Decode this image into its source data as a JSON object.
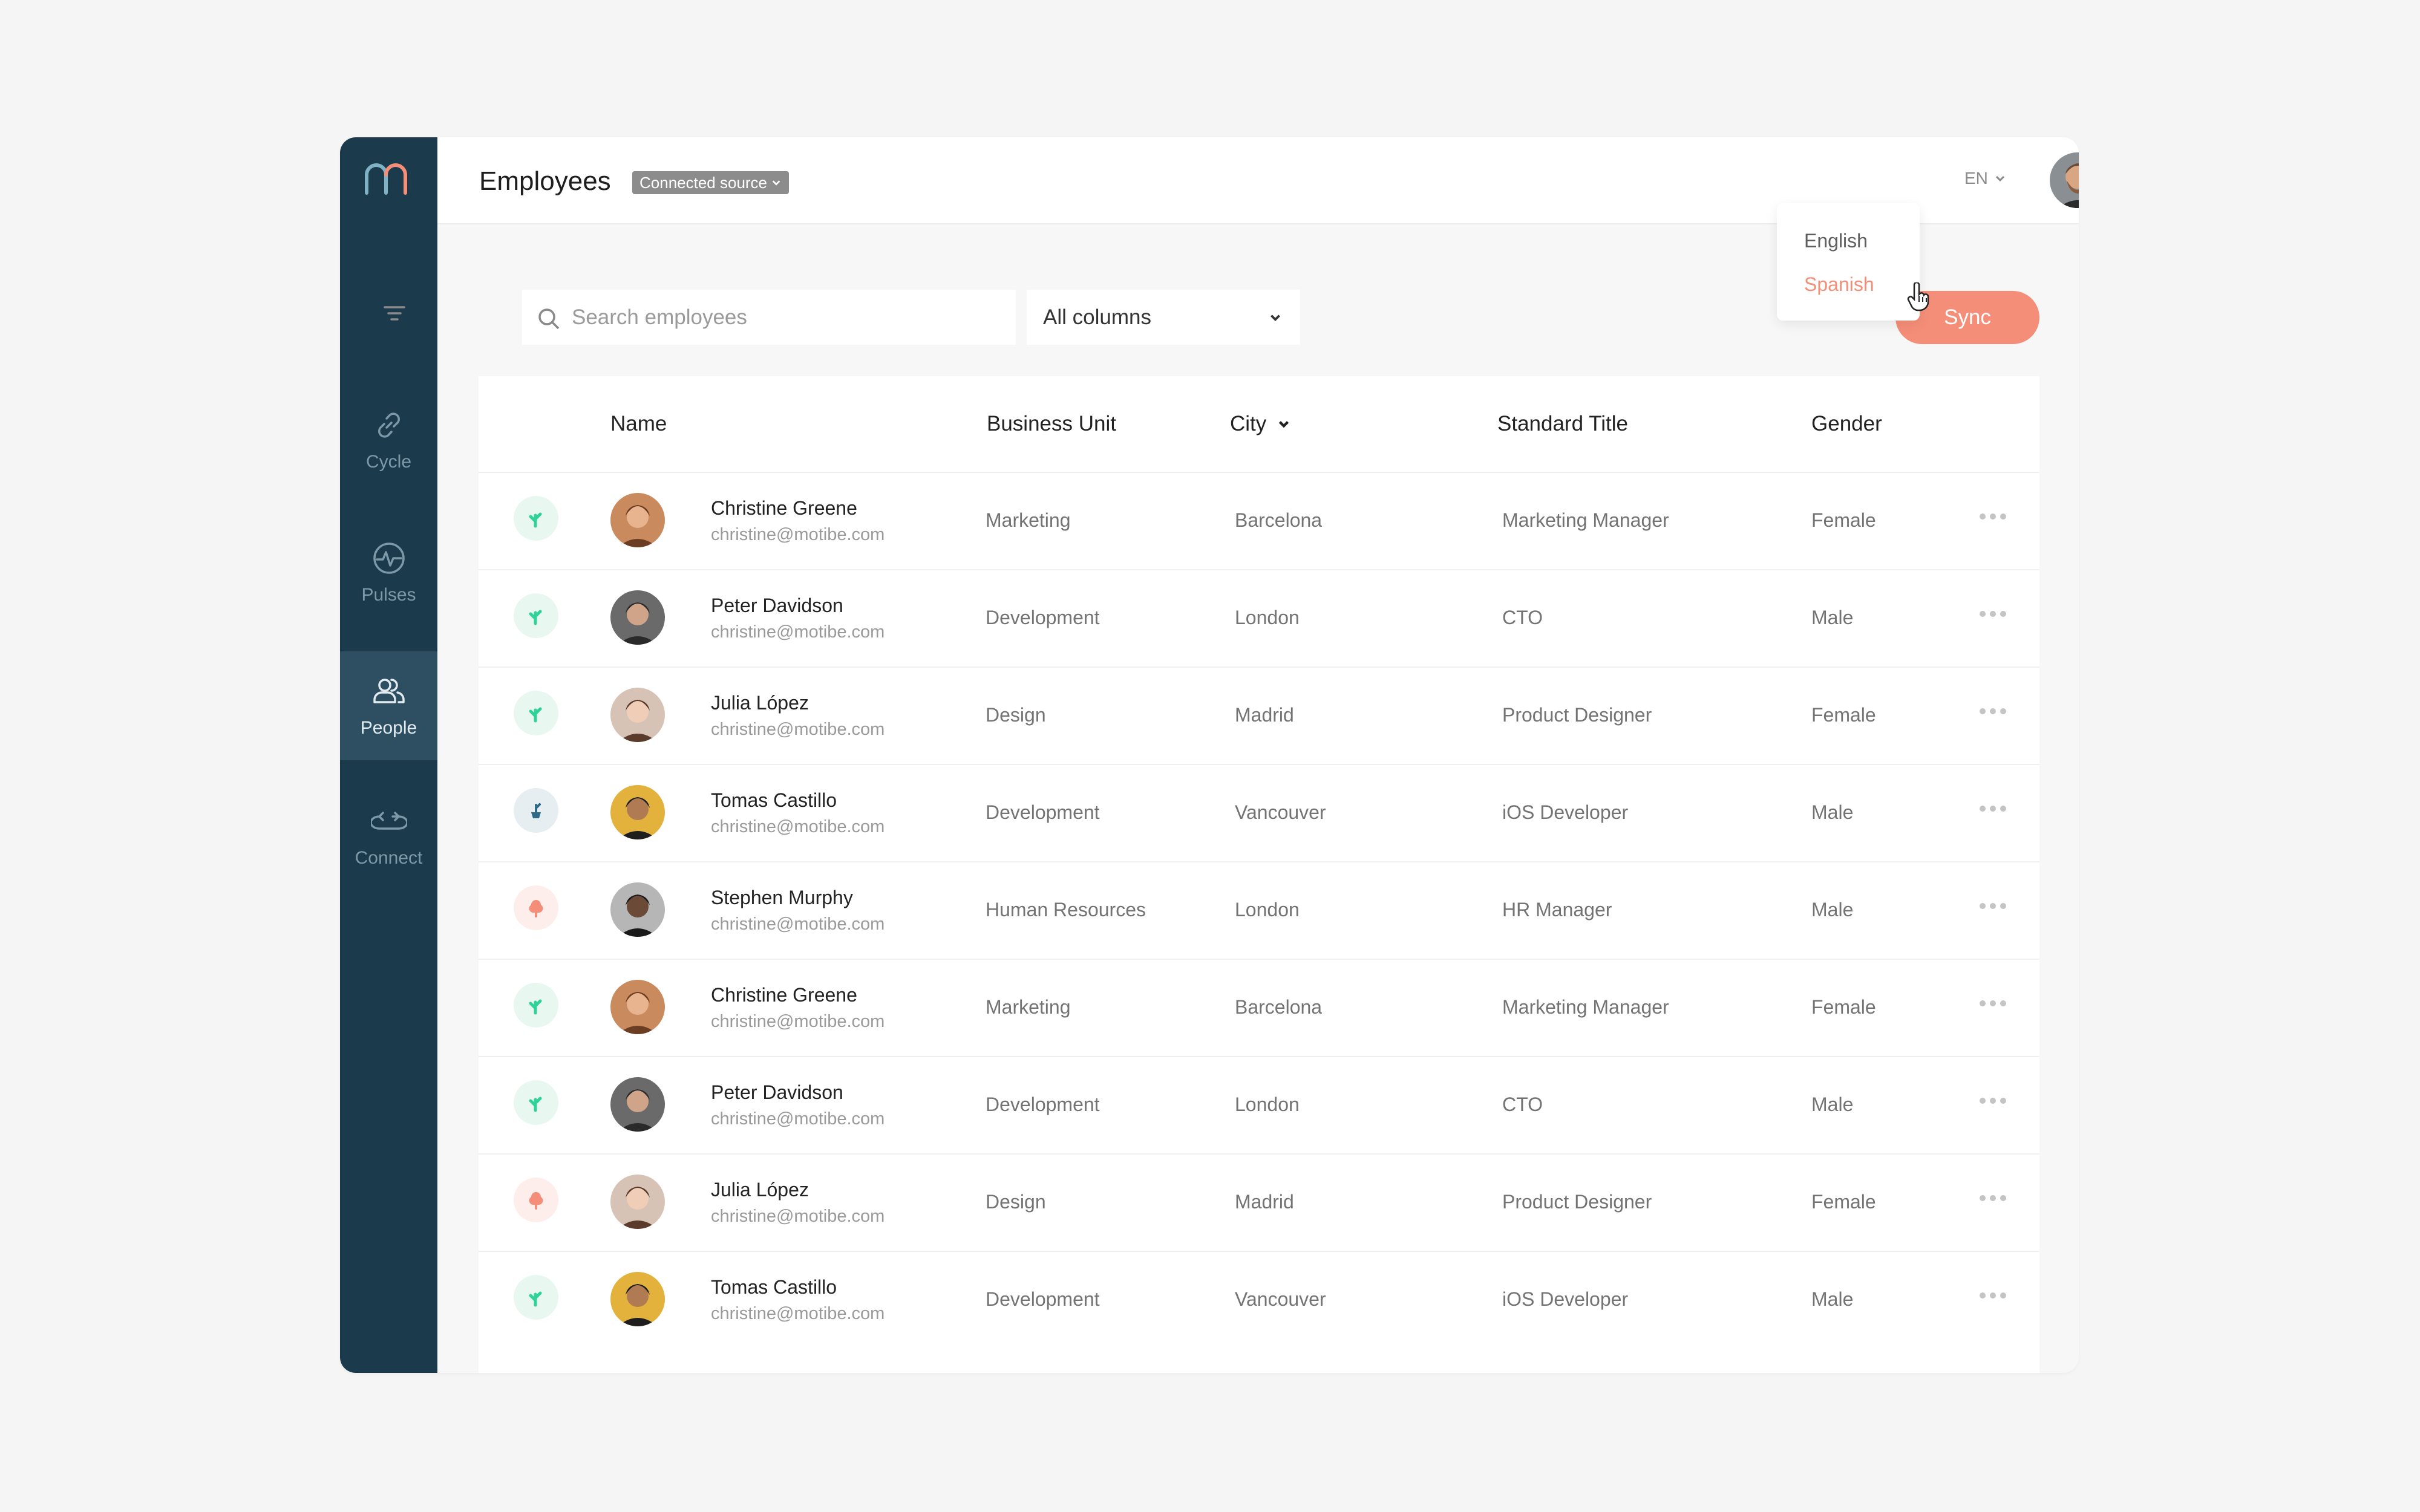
{
  "sidebar": {
    "items": [
      {
        "label": "Cycle",
        "icon": "link-icon",
        "active": false
      },
      {
        "label": "Pulses",
        "icon": "pulse-icon",
        "active": false
      },
      {
        "label": "People",
        "icon": "people-icon",
        "active": true
      },
      {
        "label": "Connect",
        "icon": "sync-icon",
        "active": false
      }
    ]
  },
  "header": {
    "title": "Employees",
    "source_badge": "Connected source",
    "language": "EN"
  },
  "language_menu": {
    "options": [
      "English",
      "Spanish"
    ],
    "highlighted": "Spanish"
  },
  "toolbar": {
    "search_placeholder": "Search employees",
    "column_filter": "All columns",
    "sync_label": "Sync"
  },
  "table": {
    "headers": [
      "Name",
      "Business Unit",
      "City",
      "Standard Title",
      "Gender"
    ],
    "rows": [
      {
        "status": "green",
        "name": "Christine Greene",
        "email": "christine@motibe.com",
        "unit": "Marketing",
        "city": "Barcelona",
        "title": "Marketing Manager",
        "gender": "Female"
      },
      {
        "status": "green",
        "name": "Peter Davidson",
        "email": "christine@motibe.com",
        "unit": "Development",
        "city": "London",
        "title": "CTO",
        "gender": "Male"
      },
      {
        "status": "green",
        "name": "Julia López",
        "email": "christine@motibe.com",
        "unit": "Design",
        "city": "Madrid",
        "title": "Product Designer",
        "gender": "Female"
      },
      {
        "status": "blue",
        "name": "Tomas Castillo",
        "email": "christine@motibe.com",
        "unit": "Development",
        "city": "Vancouver",
        "title": "iOS Developer",
        "gender": "Male"
      },
      {
        "status": "red",
        "name": "Stephen Murphy",
        "email": "christine@motibe.com",
        "unit": "Human Resources",
        "city": "London",
        "title": "HR Manager",
        "gender": "Male"
      },
      {
        "status": "green",
        "name": "Christine Greene",
        "email": "christine@motibe.com",
        "unit": "Marketing",
        "city": "Barcelona",
        "title": "Marketing Manager",
        "gender": "Female"
      },
      {
        "status": "green",
        "name": "Peter Davidson",
        "email": "christine@motibe.com",
        "unit": "Development",
        "city": "London",
        "title": "CTO",
        "gender": "Male"
      },
      {
        "status": "red",
        "name": "Julia López",
        "email": "christine@motibe.com",
        "unit": "Design",
        "city": "Madrid",
        "title": "Product Designer",
        "gender": "Female"
      },
      {
        "status": "green",
        "name": "Tomas Castillo",
        "email": "christine@motibe.com",
        "unit": "Development",
        "city": "Vancouver",
        "title": "iOS Developer",
        "gender": "Male"
      }
    ]
  },
  "colors": {
    "sidebar": "#1b3a4b",
    "accent": "#f48e78",
    "status_green": "#2fd39a",
    "status_blue": "#2e6a86",
    "status_red": "#f48e78"
  }
}
